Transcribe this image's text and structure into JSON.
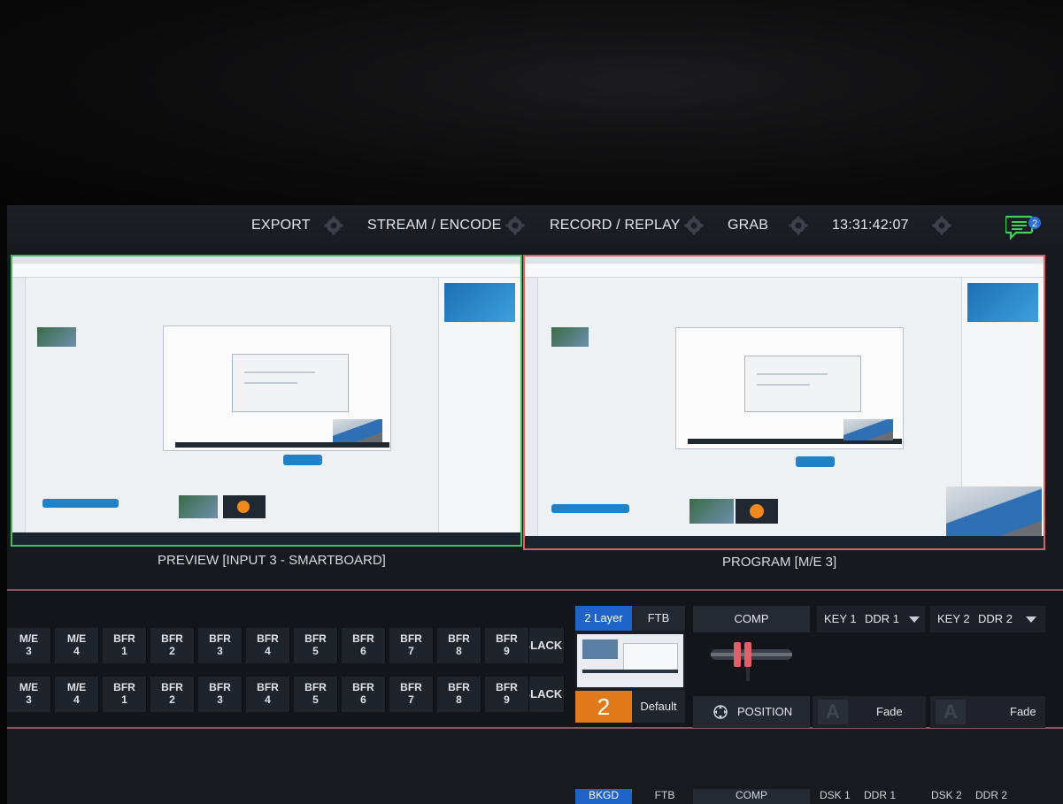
{
  "topbar": {
    "menu": [
      "EXPORT",
      "STREAM / ENCODE",
      "RECORD / REPLAY",
      "GRAB"
    ],
    "clock": "13:31:42:07",
    "notifications_count": "2",
    "icons": [
      "gear-icon",
      "chat-icon"
    ]
  },
  "monitors": {
    "preview_label": "PREVIEW [INPUT 3 - SMARTBOARD]",
    "program_label": "PROGRAM [M/E 3]",
    "preview_border_color": "#3fbf5a",
    "program_border_color": "#d86060"
  },
  "switcher": {
    "rows": [
      [
        {
          "l1": "M/E",
          "l2": "3"
        },
        {
          "l1": "M/E",
          "l2": "4"
        },
        {
          "l1": "BFR",
          "l2": "1"
        },
        {
          "l1": "BFR",
          "l2": "2"
        },
        {
          "l1": "BFR",
          "l2": "3"
        },
        {
          "l1": "BFR",
          "l2": "4"
        },
        {
          "l1": "BFR",
          "l2": "5"
        },
        {
          "l1": "BFR",
          "l2": "6"
        },
        {
          "l1": "BFR",
          "l2": "7"
        },
        {
          "l1": "BFR",
          "l2": "8"
        },
        {
          "l1": "BFR",
          "l2": "9"
        }
      ],
      [
        {
          "l1": "M/E",
          "l2": "3"
        },
        {
          "l1": "M/E",
          "l2": "4"
        },
        {
          "l1": "BFR",
          "l2": "1"
        },
        {
          "l1": "BFR",
          "l2": "2"
        },
        {
          "l1": "BFR",
          "l2": "3"
        },
        {
          "l1": "BFR",
          "l2": "4"
        },
        {
          "l1": "BFR",
          "l2": "5"
        },
        {
          "l1": "BFR",
          "l2": "6"
        },
        {
          "l1": "BFR",
          "l2": "7"
        },
        {
          "l1": "BFR",
          "l2": "8"
        },
        {
          "l1": "BFR",
          "l2": "9"
        }
      ]
    ],
    "black_label": "BLACK",
    "memory": {
      "tab_layer": "2 Layer",
      "tab_ftb": "FTB",
      "number": "2",
      "preset": "Default"
    },
    "comp_label": "COMP",
    "position_label": "POSITION",
    "key1": {
      "label": "KEY 1",
      "source": "DDR 1",
      "transition": "Fade"
    },
    "key2": {
      "label": "KEY 2",
      "source": "DDR 2",
      "transition": "Fade"
    },
    "accent_colors": {
      "blue": "#1e64c8",
      "orange": "#e07a1a",
      "tbar_red": "#e0606a"
    }
  },
  "lower": {
    "tab_bkgd": "BKGD",
    "tab_ftb": "FTB",
    "comp_label": "COMP",
    "dsk1_label": "DSK 1",
    "dsk1_source": "DDR 1",
    "dsk2_label": "DSK 2",
    "dsk2_source": "DDR 2"
  }
}
